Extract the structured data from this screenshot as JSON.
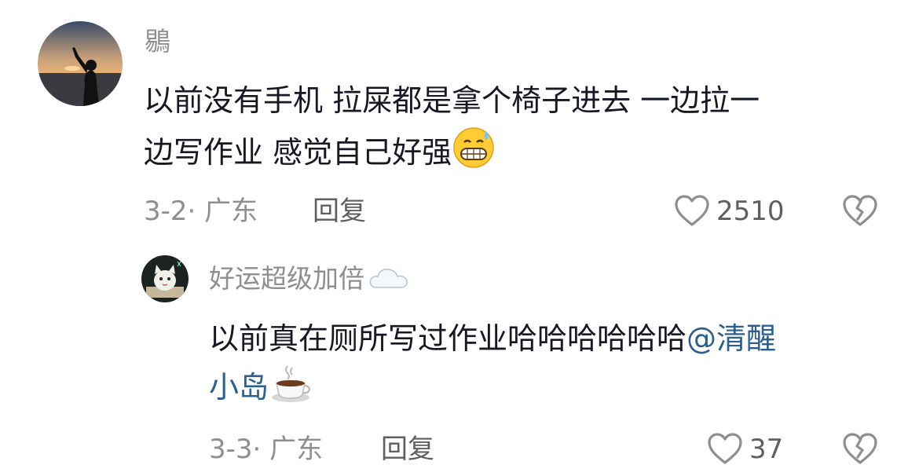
{
  "comments": [
    {
      "username": "鶍",
      "text_line1": "以前没有手机 拉屎都是拿个椅子进去 一边拉一",
      "text_line2": "边写作业 感觉自己好强",
      "emoji_icon": "grin-sweat-icon",
      "date_location": "3-2· 广东",
      "reply_label": "回复",
      "like_count": "2510"
    },
    {
      "username": "好运超级加倍",
      "username_emoji_icon": "cloud-icon",
      "text_line1": "以前真在厕所写过作业哈哈哈哈哈哈",
      "mention_part1": "@清醒",
      "mention_part2": "小岛",
      "emoji_icon": "hot-coffee-icon",
      "date_location": "3-3· 广东",
      "reply_label": "回复",
      "like_count": "37"
    }
  ],
  "colors": {
    "text": "#161823",
    "secondary": "#8e8e93",
    "mention": "#2a5f8f"
  }
}
